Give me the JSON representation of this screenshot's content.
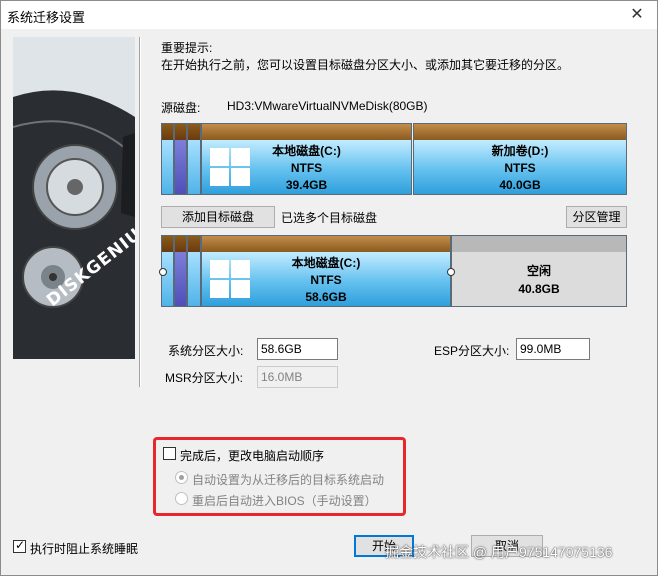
{
  "window": {
    "title": "系统迁移设置",
    "close_symbol": "✕"
  },
  "tip": {
    "title": "重要提示:",
    "body": "在开始执行之前，您可以设置目标磁盘分区大小、或添加其它要迁移的分区。"
  },
  "source": {
    "label": "源磁盘:",
    "name": "HD3:VMwareVirtualNVMeDisk(80GB)"
  },
  "source_disk": {
    "partitions": [
      {
        "label": "本地磁盘(C:)",
        "fs": "NTFS",
        "size": "39.4GB"
      },
      {
        "label": "新加卷(D:)",
        "fs": "NTFS",
        "size": "40.0GB"
      }
    ]
  },
  "target_bar": {
    "add_button": "添加目标磁盘",
    "selected_text": "已选多个目标磁盘",
    "partition_mgmt_button": "分区管理"
  },
  "target_disk": {
    "partitions": [
      {
        "label": "本地磁盘(C:)",
        "fs": "NTFS",
        "size": "58.6GB"
      },
      {
        "label": "空闲",
        "size": "40.8GB"
      }
    ]
  },
  "sizes": {
    "system_label": "系统分区大小:",
    "system_value": "58.6GB",
    "esp_label": "ESP分区大小:",
    "esp_value": "99.0MB",
    "msr_label": "MSR分区大小:",
    "msr_value": "16.0MB"
  },
  "boot_options": {
    "change_boot_order": "完成后，更改电脑启动顺序",
    "auto_boot": "自动设置为从迁移后的目标系统启动",
    "bios_boot": "重启后自动进入BIOS（手动设置）"
  },
  "footer": {
    "prevent_sleep": "执行时阻止系统睡眠",
    "start_button": "开始",
    "cancel_button": "取消"
  },
  "watermark": "掘金技术社区 @ 用户975147075136",
  "brand": {
    "logo_text": "DISKGENIUS"
  },
  "colors": {
    "highlight": "#e8262b",
    "partition_cap": "#8a5a1e",
    "partition_body": "#64c1ef"
  }
}
